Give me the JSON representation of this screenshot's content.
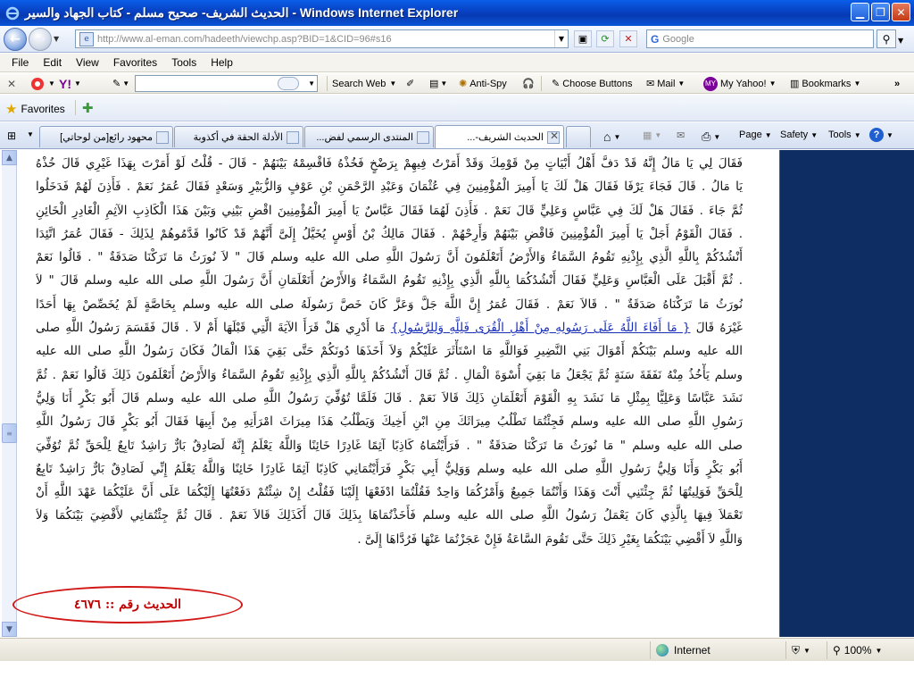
{
  "window": {
    "title": "الحديث الشريف- صحيح مسلم - كتاب الجهاد والسير - Windows Internet Explorer"
  },
  "address_bar": {
    "url": "http://www.al-eman.com/hadeeth/viewchp.asp?BID=1&CID=96#s16",
    "search_placeholder": "Google"
  },
  "menu": {
    "items": [
      "File",
      "Edit",
      "View",
      "Favorites",
      "Tools",
      "Help"
    ]
  },
  "toolbar": {
    "search_web": "Search Web",
    "anti_spy": "Anti-Spy",
    "choose_buttons": "Choose Buttons",
    "mail": "Mail",
    "my_yahoo": "My Yahoo!",
    "bookmarks": "Bookmarks"
  },
  "favorites_bar": {
    "favorites_label": "Favorites"
  },
  "tabs": [
    {
      "label": "محهود رائع[من لوحاتي]"
    },
    {
      "label": "الأدلة الحقة في أكذوبة"
    },
    {
      "label": "المنتدى الرسمي لفض..."
    },
    {
      "label": "الحديث الشريف-..."
    }
  ],
  "commands": {
    "page": "Page",
    "safety": "Safety",
    "tools": "Tools"
  },
  "content": {
    "lines": [
      "فَقَالَ لِي يَا مَالُ إِنَّهُ قَدْ دَفَّ أَهْلُ أَبْيَاتٍ مِنْ قَوْمِكَ وَقَدْ أَمَرْتُ فِيهِمْ بِرَضْخٍ فَخُذْهُ فَاقْسِمْهُ بَيْنَهُمْ - قَالَ - قُلْتُ لَوْ أَمَرْتَ بِهَذَا غَيْرِي قَالَ خُذْهُ",
      "يَا مَالُ . قَالَ فَجَاءَ يَرْفَا فَقَالَ هَلْ لَكَ يَا أَمِيرَ الْمُؤْمِنِينَ فِي عُثْمَانَ وَعَبْدِ الرَّحْمَنِ بْنِ عَوْفٍ وَالزُّبَيْرِ وَسَعْدٍ فَقَالَ عُمَرُ نَعَمْ . فَأَذِنَ لَهُمْ فَدَخَلُوا",
      "ثُمَّ جَاءَ . فَقَالَ هَلْ لَكَ فِي عَبَّاسٍ وَعَلِيٍّ قَالَ نَعَمْ . فَأَذِنَ لَهُمَا فَقَالَ عَبَّاسٌ يَا أَمِيرَ الْمُؤْمِنِينَ اقْضِ بَيْنِي وَبَيْنَ هَذَا الْكَاذِبِ الآثِمِ الْغَادِرِ الْخَائِنِ",
      ". فَقَالَ الْقَوْمُ أَجَلْ يَا أَمِيرَ الْمُؤْمِنِينَ فَاقْضِ بَيْنَهُمْ وَأَرِحْهُمْ . فَقَالَ مَالِكُ بْنُ أَوْسٍ يُخَيَّلُ إِلَىَّ أَنَّهُمْ قَدْ كَانُوا قَدَّمُوهُمْ لِذَلِكَ - فَقَالَ عُمَرُ اتَّئِدَا",
      "أَنْشُدُكُمْ بِاللَّهِ الَّذِي بِإِذْنِهِ تَقُومُ السَّمَاءُ وَالأَرْضُ أَتَعْلَمُونَ أَنَّ رَسُولَ اللَّهِ صلى الله عليه وسلم قَالَ \" لاَ نُورَثُ مَا تَرَكْنَا صَدَقَةٌ \" . قَالُوا نَعَمْ",
      ". ثُمَّ أَقْبَلَ عَلَى الْعَبَّاسِ وَعَلِيٍّ فَقَالَ أَنْشُدُكُمَا بِاللَّهِ الَّذِي بِإِذْنِهِ تَقُومُ السَّمَاءُ وَالأَرْضُ أَتَعْلَمَانِ أَنَّ رَسُولَ اللَّهِ صلى الله عليه وسلم قَالَ \" لاَ",
      "نُورَثُ مَا تَرَكْنَاهُ صَدَقَةٌ \" . قَالاَ نَعَمْ . فَقَالَ عُمَرُ إِنَّ اللَّهَ جَلَّ وَعَزَّ كَانَ خَصَّ رَسُولَهُ صلى الله عليه وسلم بِخَاصَّةٍ لَمْ يُخَصِّصْ بِهَا أَحَدًا",
      "غَيْرَهُ قَالَ { مَا أَفَاءَ اللَّهُ عَلَى رَسُولِهِ مِنْ أَهْلِ الْقُرَى فَلِلَّهِ وَلِلرَّسُولِ} مَا أَدْرِي هَلْ قَرَأَ الآيَةَ الَّتِي قَبْلَهَا أَمْ لاَ . قَالَ فَقَسَمَ رَسُولُ اللَّهِ صلى",
      "الله عليه وسلم بَيْنَكُمْ أَمْوَالَ بَنِي النَّضِيرِ فَوَاللَّهِ مَا اسْتَأْثَرَ عَلَيْكُمْ وَلاَ أَخَذَهَا دُونَكُمْ حَتَّى بَقِيَ هَذَا الْمَالُ فَكَانَ رَسُولُ اللَّهِ صلى الله عليه",
      "وسلم يَأْخُذُ مِنْهُ نَفَقَةَ سَنَةٍ ثُمَّ يَجْعَلُ مَا بَقِيَ أُسْوَةَ الْمَالِ . ثُمَّ قَالَ أَنْشُدُكُمْ بِاللَّهِ الَّذِي بِإِذْنِهِ تَقُومُ السَّمَاءُ وَالأَرْضُ أَتَعْلَمُونَ ذَلِكَ قَالُوا نَعَمْ . ثُمَّ",
      "نَشَدَ عَبَّاسًا وَعَلِيًّا بِمِثْلِ مَا نَشَدَ بِهِ الْقَوْمَ أَتَعْلَمَانِ ذَلِكَ قَالاَ نَعَمْ . قَالَ فَلَمَّا تُوُفِّيَ رَسُولُ اللَّهِ صلى الله عليه وسلم قَالَ أَبُو بَكْرٍ أَنَا وَلِيُّ",
      "رَسُولِ اللَّهِ صلى الله عليه وسلم فَجِئْتُمَا تَطْلُبُ مِيرَاثَكَ مِنِ ابْنِ أَخِيكَ وَيَطْلُبُ هَذَا مِيرَاثَ امْرَأَتِهِ مِنْ أَبِيهَا فَقَالَ أَبُو بَكْرٍ قَالَ رَسُولُ اللَّهِ",
      "صلى الله عليه وسلم \" مَا نُورَثُ مَا تَرَكْنَا صَدَقَةٌ \" . فَرَأَيْتُمَاهُ كَاذِبًا آثِمًا غَادِرًا خَائِنًا وَاللَّهُ يَعْلَمُ إِنَّهُ لَصَادِقٌ بَارٌّ رَاشِدٌ تَابِعٌ لِلْحَقِّ ثُمَّ تُوُفِّيَ",
      "أَبُو بَكْرٍ وَأَنَا وَلِيُّ رَسُولِ اللَّهِ صلى الله عليه وسلم وَوَلِيُّ أَبِي بَكْرٍ فَرَأَيْتُمَانِي كَاذِبًا آثِمًا غَادِرًا خَائِنًا وَاللَّهُ يَعْلَمُ إِنِّي لَصَادِقٌ بَارٌّ رَاشِدٌ تَابِعٌ",
      "لِلْحَقِّ فَوَلِيتُهَا ثُمَّ جِئْتَنِي أَنْتَ وَهَذَا وَأَنْتُمَا جَمِيعٌ وَأَمْرُكُمَا وَاحِدٌ فَقُلْتُمَا ادْفَعْهَا إِلَيْنَا فَقُلْتُ إِنْ شِئْتُمْ دَفَعْتُهَا إِلَيْكُمَا عَلَى أَنَّ عَلَيْكُمَا عَهْدَ اللَّهِ أَنْ",
      "تَعْمَلاَ فِيهَا بِالَّذِي كَانَ يَعْمَلُ رَسُولُ اللَّهِ صلى الله عليه وسلم فَأَخَذْتُمَاهَا بِذَلِكَ قَالَ أَكَذَلِكَ قَالاَ نَعَمْ . قَالَ ثُمَّ جِئْتُمَانِي لأَقْضِيَ بَيْنَكُمَا وَلاَ",
      "وَاللَّهِ لاَ أَقْضِي بَيْنَكُمَا بِغَيْرِ ذَلِكَ حَتَّى تَقُومَ السَّاعَةُ فَإِنْ عَجَزْتُمَا عَنْهَا فَرُدَّاهَا إِلَىَّ ."
    ],
    "link_text": "{ مَا أَفَاءَ اللَّهُ عَلَى رَسُولِهِ مِنْ أَهْلِ الْقُرَى فَلِلَّهِ وَلِلرَّسُولِ}",
    "hadith_badge": "الحديث رقم :: ٤٦٧٦"
  },
  "statusbar": {
    "zone": "Internet",
    "zoom": "100%"
  },
  "colors": {
    "titlebar": "#0841c2",
    "side_panel": "#0d2d63",
    "badge": "#c00000",
    "link": "#1a2fb8"
  }
}
